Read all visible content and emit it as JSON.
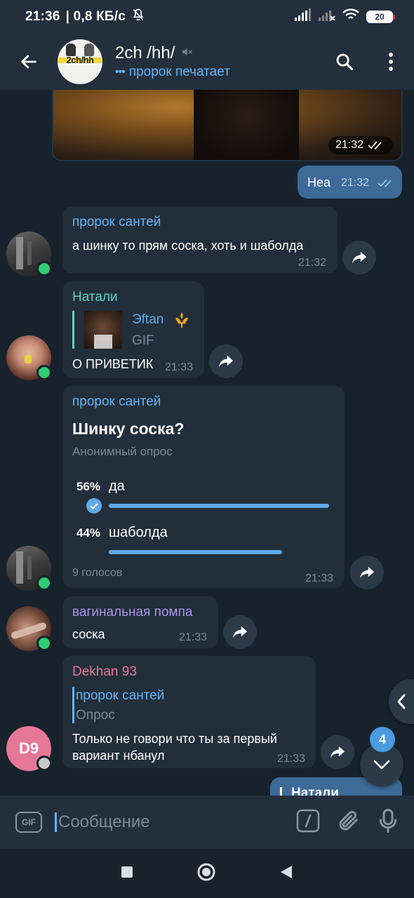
{
  "status_bar": {
    "time": "21:36",
    "net_speed": "| 0,8 КБ/с",
    "battery": "20"
  },
  "header": {
    "title": "2ch /hh/",
    "status": "пророк печатает",
    "avatar_text": "2ch/hh"
  },
  "messages": {
    "media": {
      "time": "21:32"
    },
    "out1": {
      "text": "Неа",
      "time": "21:32"
    },
    "m1": {
      "name": "пророк сантей",
      "text": "а шинку то прям соска, хоть и шаболда",
      "time": "21:32"
    },
    "m2": {
      "name": "Натали",
      "reply_name": "Эftan",
      "reply_type": "GIF",
      "text": "О ПРИВЕТИК",
      "time": "21:33"
    },
    "poll": {
      "name": "пророк сантей",
      "question": "Шинку соска?",
      "kind": "Анонимный опрос",
      "options": [
        {
          "percent": "56%",
          "label": "да",
          "value": 56
        },
        {
          "percent": "44%",
          "label": "шаболда",
          "value": 44
        }
      ],
      "votes": "9 голосов",
      "time": "21:33"
    },
    "m3": {
      "name": "вагинальная помпа",
      "text": "соска",
      "time": "21:33"
    },
    "m4": {
      "name": "Dekhan 93",
      "reply_name": "пророк сантей",
      "reply_type": "Опрос",
      "line1": "Только не говори что ты за первый",
      "line2": "вариант нбанул",
      "time": "21:33",
      "avatar": "D9"
    },
    "out2": {
      "reply_name": "Натали"
    }
  },
  "unread_count": "4",
  "input": {
    "placeholder": "Сообщение",
    "gif": "GIF"
  },
  "colors": {
    "accent": "#64b5f6",
    "name_natali": "#5ed3c7",
    "name_pompa": "#a695e7",
    "name_dekhan": "#e57896",
    "online": "#2ecc71"
  }
}
